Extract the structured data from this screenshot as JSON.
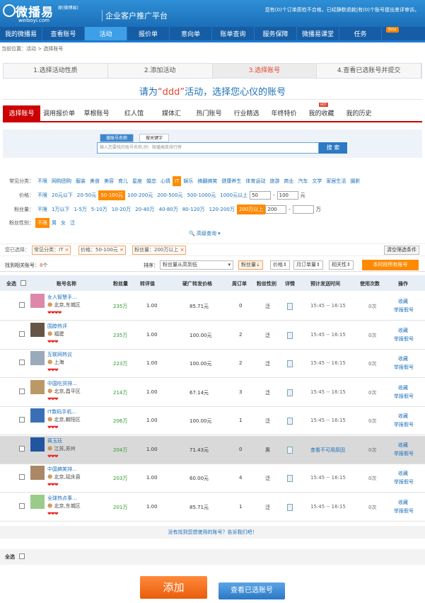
{
  "header": {
    "logo": "微播易",
    "logo_sub": "原(微博易)",
    "logo_url": "weiboyi.com",
    "platform": "企业客户推广平台",
    "notice": "您有(0)个订单质检不合格，已经静默退款|有(0)个账号提出差评审诉。"
  },
  "nav": [
    "我的微播易",
    "查看账号",
    "活动",
    "报价单",
    "意向单",
    "账单查询",
    "服务保障",
    "微播易课堂",
    "任务"
  ],
  "nav_beta": "Beta",
  "breadcrumb": "当前位置：活动 > 选择账号",
  "steps": [
    "1.选择活动性质",
    "2.添加活动",
    "3.选择账号",
    "4.查看已选账号并提交"
  ],
  "title": {
    "pre": "请为",
    "name": "“ddd”",
    "post": "活动，选择您心仪的账号"
  },
  "tabs": [
    "选择账号",
    "调用报价单",
    "草根账号",
    "红人馆",
    "媒体汇",
    "热门账号",
    "行业精选",
    "年终特价",
    "我的收藏",
    "我的历史"
  ],
  "hot": "HOT",
  "search": {
    "tab1": "搜账号名称",
    "tab2": "搜关键字",
    "placeholder": "输入您要找的账号名称,例：微播搞笑排行榜",
    "button": "搜 索"
  },
  "filters": {
    "category_label": "常见分类：",
    "category": [
      "不限",
      "网购团购",
      "服装",
      "美食",
      "美容",
      "育儿",
      "星座",
      "婚恋",
      "心情",
      "IT",
      "娱乐",
      "搞翻搞笑",
      "健康养生",
      "体育运动",
      "旅游",
      "商业",
      "汽车",
      "文学",
      "家居生活",
      "摄影"
    ],
    "price_label": "价格：",
    "price": [
      "不限",
      "20元以下",
      "20-50元",
      "50-100元",
      "100-200元",
      "200-500元",
      "500-1000元",
      "1000元以上"
    ],
    "price_min": "50",
    "price_max": "100",
    "price_unit": "元",
    "fans_label": "粉丝量：",
    "fans": [
      "不限",
      "1万以下",
      "1-5万",
      "5-10万",
      "10-20万",
      "20-40万",
      "40-80万",
      "80-120万",
      "120-200万",
      "200万以上"
    ],
    "fans_min": "200",
    "fans_unit": "万",
    "gender_label": "粉丝性别：",
    "gender": [
      "不限",
      "男",
      "女",
      "泛"
    ]
  },
  "advanced": "高级查询",
  "chosen": {
    "label": "您已选择：",
    "chips": [
      "常见分类：IT",
      "价格：50-100元",
      "粉丝量：200万以上"
    ],
    "clear": "清空筛选条件"
  },
  "sort": {
    "found_pre": "找到相关账号：",
    "found_count": "8",
    "found_post": "个",
    "label": "排序：",
    "select": "粉丝量从高到低",
    "b1": "粉丝量",
    "b2": "价格",
    "b3": "月订单量",
    "b4": "相关性",
    "all": "本时段所有账号"
  },
  "columns": [
    "全选",
    "账号名称",
    "粉丝量",
    "转评值",
    "硬广转发价格",
    "周订单",
    "粉丝性别",
    "详情",
    "预计发送时间",
    "使用次数",
    "操作"
  ],
  "rows": [
    {
      "name": "女人智慧手...",
      "loc": "北京,东城区",
      "fans": "235万",
      "score": "1.00",
      "price": "85.71元",
      "orders": "0",
      "gender": "泛",
      "time": "15:45 -- 16:15",
      "uses": "0次",
      "a1": "收藏",
      "a2": "举报假号"
    },
    {
      "name": "围脖热评",
      "loc": "福建",
      "fans": "235万",
      "score": "1.00",
      "price": "100.00元",
      "orders": "2",
      "gender": "泛",
      "time": "15:45 -- 16:15",
      "uses": "0次",
      "a1": "收藏",
      "a2": "举报假号"
    },
    {
      "name": "互联网热议",
      "loc": "上海",
      "fans": "223万",
      "score": "1.00",
      "price": "100.00元",
      "orders": "2",
      "gender": "泛",
      "time": "15:45 -- 16:15",
      "uses": "0次",
      "a1": "收藏",
      "a2": "举报假号"
    },
    {
      "name": "中国吃货排...",
      "loc": "北京,昌平区",
      "fans": "214万",
      "score": "1.00",
      "price": "67.14元",
      "orders": "3",
      "gender": "泛",
      "time": "15:45 -- 16:15",
      "uses": "0次",
      "a1": "收藏",
      "a2": "举报假号"
    },
    {
      "name": "IT数码手机...",
      "loc": "北京,朝阳区",
      "fans": "206万",
      "score": "1.00",
      "price": "100.00元",
      "orders": "1",
      "gender": "泛",
      "time": "15:45 -- 16:15",
      "uses": "0次",
      "a1": "收藏",
      "a2": "举报假号"
    },
    {
      "name": "蒋玉珏",
      "loc": "江苏,苏州",
      "fans": "204万",
      "score": "1.00",
      "price": "71.43元",
      "orders": "0",
      "gender": "男",
      "time": "查看不可用原因",
      "uses": "0次",
      "a1": "收藏",
      "a2": "举报假号"
    },
    {
      "name": "中国搞笑排...",
      "loc": "北京,延庆县",
      "fans": "203万",
      "score": "1.00",
      "price": "60.00元",
      "orders": "4",
      "gender": "泛",
      "time": "15:45 -- 16:15",
      "uses": "0次",
      "a1": "收藏",
      "a2": "举报假号"
    },
    {
      "name": "全球热点事...",
      "loc": "北京,东城区",
      "fans": "201万",
      "score": "1.00",
      "price": "85.71元",
      "orders": "1",
      "gender": "泛",
      "time": "15:45 -- 16:15",
      "uses": "0次",
      "a1": "收藏",
      "a2": "举报假号"
    }
  ],
  "row_hearts": [
    "❤❤❤❤",
    "❤❤❤",
    "❤❤❤",
    "❤❤❤",
    "❤❤❤",
    "❤❤❤",
    "❤❤❤",
    "❤❤❤"
  ],
  "footer_msg": "没有找到您想使用的账号？告诉我们吧！",
  "select_all": "全选",
  "add_button": "添加",
  "view_button": "查看已选账号"
}
